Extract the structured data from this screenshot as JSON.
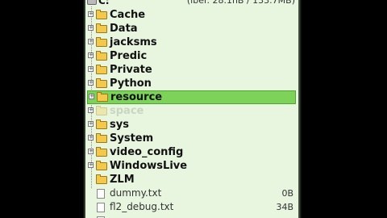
{
  "header": {
    "drive": "C:",
    "space": "(iber. 28.1nB / 133.7MB)"
  },
  "folders": [
    {
      "name": "Cache"
    },
    {
      "name": "Data"
    },
    {
      "name": "jacksms"
    },
    {
      "name": "Predic"
    },
    {
      "name": "Private"
    },
    {
      "name": "Python"
    },
    {
      "name": "resource"
    },
    {
      "name": "space"
    },
    {
      "name": "sys"
    },
    {
      "name": "System"
    },
    {
      "name": "video_config"
    },
    {
      "name": "WindowsLive"
    },
    {
      "name": "ZLM"
    }
  ],
  "files": [
    {
      "name": "dummy.txt",
      "size": "0B"
    },
    {
      "name": "fl2_debug.txt",
      "size": "34B"
    },
    {
      "name": "",
      "size": ""
    }
  ],
  "selected_folder": "resource"
}
